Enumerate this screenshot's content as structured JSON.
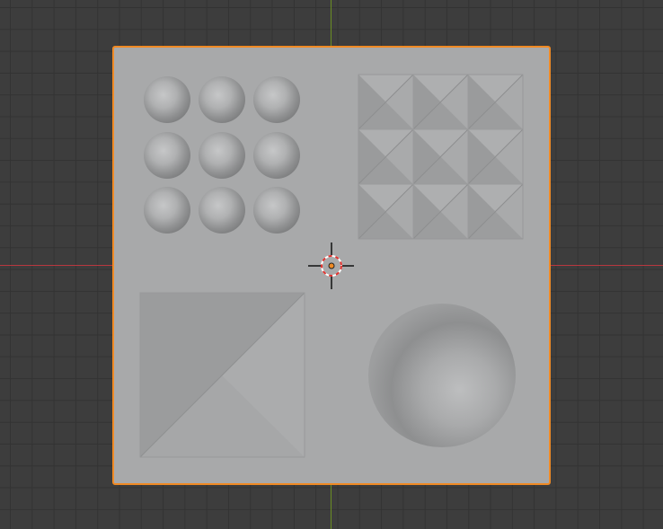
{
  "scene": {
    "view": "3d-viewport-top-orthographic",
    "background_color": "#3d3d3d",
    "grid_line_color": "#333333",
    "x_axis_color": "#b8373f",
    "y_axis_color": "#6b8e23",
    "selection_outline_color": "#f08a24",
    "plane_color": "#a8a9aa",
    "object": {
      "type": "plane-with-displacement",
      "selected": true,
      "features": {
        "sphere_bumps": {
          "rows": 3,
          "columns": 3
        },
        "pyramid_tiles": {
          "rows": 3,
          "columns": 3
        },
        "large_pyramid": 1,
        "dome_depression": 1
      }
    },
    "origin_marker": "3d-cursor"
  }
}
